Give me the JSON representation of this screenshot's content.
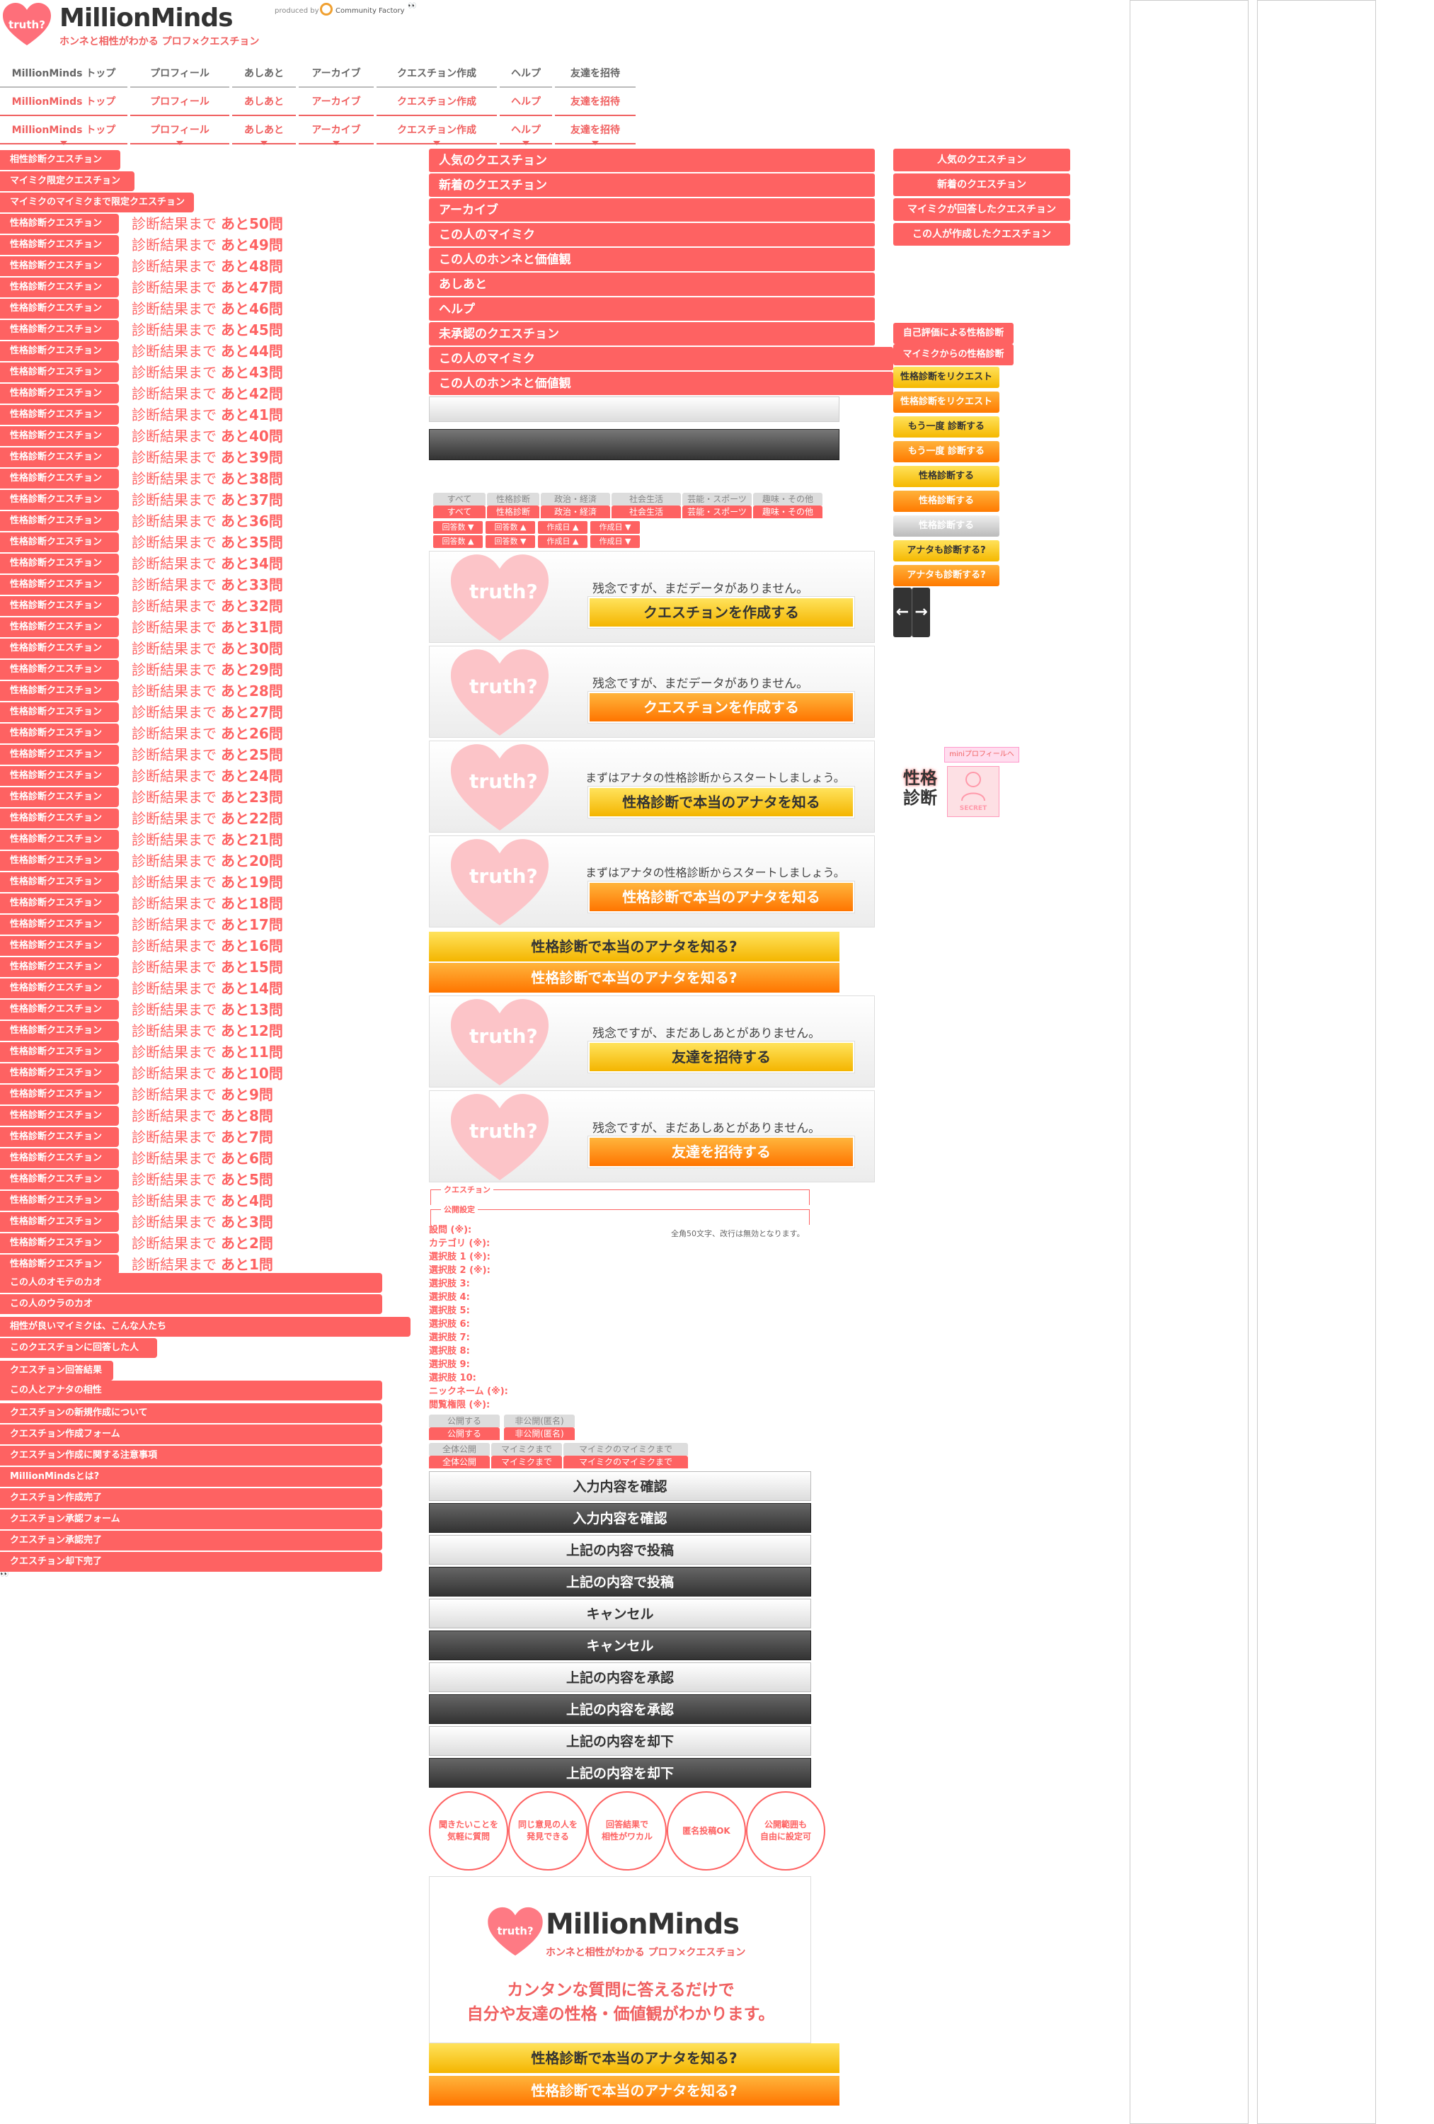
{
  "header": {
    "logo_badge": "truth?",
    "logo": "MillionMinds",
    "tagline": "ホンネと相性がわかる プロフ×クエスチョン",
    "produced_by": "produced by",
    "company": "Community Factory",
    "eyes": "👀"
  },
  "nav": [
    "MillionMinds トップ",
    "プロフィール",
    "あしあと",
    "アーカイブ",
    "クエスチョン作成",
    "ヘルプ",
    "友達を招待"
  ],
  "left_top": [
    "相性診断クエスチョン",
    "マイミク限定クエスチョン",
    "マイミクのマイミクまで限定クエスチョン"
  ],
  "diag_label": "性格診断クエスチョン",
  "remain_prefix": "診断結果まで",
  "remain_counts": [
    "あと50問",
    "あと49問",
    "あと48問",
    "あと47問",
    "あと46問",
    "あと45問",
    "あと44問",
    "あと43問",
    "あと42問",
    "あと41問",
    "あと40問",
    "あと39問",
    "あと38問",
    "あと37問",
    "あと36問",
    "あと35問",
    "あと34問",
    "あと33問",
    "あと32問",
    "あと31問",
    "あと30問",
    "あと29問",
    "あと28問",
    "あと27問",
    "あと26問",
    "あと25問",
    "あと24問",
    "あと23問",
    "あと22問",
    "あと21問",
    "あと20問",
    "あと19問",
    "あと18問",
    "あと17問",
    "あと16問",
    "あと15問",
    "あと14問",
    "あと13問",
    "あと12問",
    "あと11問",
    "あと10問",
    "あと9問",
    "あと8問",
    "あと7問",
    "あと6問",
    "あと5問",
    "あと4問",
    "あと3問",
    "あと2問",
    "あと1問"
  ],
  "left_bottom": [
    "この人のオモテのカオ",
    "この人のウラのカオ",
    "相性が良いマイミクは、こんな人たち",
    "このクエスチョンに回答した人",
    "クエスチョン回答結果",
    "この人とアナタの相性",
    "クエスチョンの新規作成について",
    "クエスチョン作成フォーム",
    "クエスチョン作成に関する注意事項",
    "MillionMindsとは?",
    "クエスチョン作成完了",
    "クエスチョン承認フォーム",
    "クエスチョン承認完了",
    "クエスチョン却下完了"
  ],
  "center_menu": [
    "人気のクエスチョン",
    "新着のクエスチョン",
    "アーカイブ",
    "この人のマイミク",
    "この人のホンネと価値観",
    "あしあと",
    "ヘルプ",
    "未承認のクエスチョン",
    "この人のマイミク",
    "この人のホンネと価値観"
  ],
  "right_menu": [
    "人気のクエスチョン",
    "新着のクエスチョン",
    "マイミクが回答したクエスチョン",
    "この人が作成したクエスチョン"
  ],
  "right_diag": [
    "自己評価による性格診断",
    "マイミクからの性格診断"
  ],
  "right_small": [
    "性格診断をリクエスト",
    "性格診断をリクエスト",
    "もう一度 診断する",
    "もう一度 診断する",
    "性格診断する",
    "性格診断する",
    "性格診断する",
    "アナタも診断する?",
    "アナタも診断する?"
  ],
  "arrows": [
    "←",
    "→"
  ],
  "tabs": [
    "すべて",
    "性格診断",
    "政治・経済",
    "社会生活",
    "芸能・スポーツ",
    "趣味・その他"
  ],
  "sort": [
    "回答数 ▼",
    "回答数 ▲",
    "作成日 ▲",
    "作成日 ▼"
  ],
  "sort2": [
    "回答数 ▲",
    "回答数 ▼",
    "作成日 ▲",
    "作成日 ▼"
  ],
  "panels": [
    {
      "msg": "残念ですが、まだデータがありません。",
      "btn": "クエスチョンを作成する"
    },
    {
      "msg": "残念ですが、まだデータがありません。",
      "btn": "クエスチョンを作成する"
    },
    {
      "msg": "まずはアナタの性格診断からスタートしましょう。",
      "btn": "性格診断で本当のアナタを知る"
    },
    {
      "msg": "まずはアナタの性格診断からスタートしましょう。",
      "btn": "性格診断で本当のアナタを知る"
    },
    {
      "msg": "残念ですが、まだあしあとがありません。",
      "btn": "友達を招待する"
    },
    {
      "msg": "残念ですが、まだあしあとがありません。",
      "btn": "友達を招待する"
    }
  ],
  "big_know": "性格診断で本当のアナタを知る?",
  "badge": {
    "mini_profile": "miniプロフィールへ",
    "seikaku": "性格",
    "shindan": "診断",
    "secret": "SECRET"
  },
  "form": {
    "legend_q": "クエスチョン",
    "legend_pub": "公開設定",
    "hint": "全角50文字、改行は無効となります。",
    "fields": [
      "設問 (※):",
      "カテゴリ (※):",
      "選択肢 1 (※):",
      "選択肢 2 (※):",
      "選択肢 3:",
      "選択肢 4:",
      "選択肢 5:",
      "選択肢 6:",
      "選択肢 7:",
      "選択肢 8:",
      "選択肢 9:",
      "選択肢 10:",
      "ニックネーム (※):",
      "閲覧権限 (※):"
    ],
    "pub": [
      "公開する",
      "非公開(匿名)"
    ],
    "scope": [
      "全体公開",
      "マイミクまで",
      "マイミクのマイミクまで"
    ]
  },
  "buttons": [
    "入力内容を確認",
    "入力内容を確認",
    "上記の内容で投稿",
    "上記の内容で投稿",
    "キャンセル",
    "キャンセル",
    "上記の内容を承認",
    "上記の内容を承認",
    "上記の内容を却下",
    "上記の内容を却下"
  ],
  "circles": [
    "聞きたいことを\n気軽に質問",
    "同じ意見の人を\n発見できる",
    "回答結果で\n相性がワカル",
    "匿名投稿OK",
    "公開範囲も\n自由に設定可"
  ],
  "promo": {
    "line1": "カンタンな質問に答えるだけで",
    "line2": "自分や友達の性格・価値観がわかります。"
  }
}
